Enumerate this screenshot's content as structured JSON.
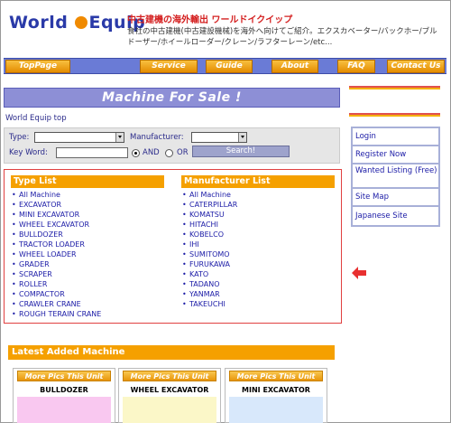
{
  "header": {
    "logo_word1": "World",
    "logo_word2": "quip",
    "logo_letter": "E",
    "tagline": "中古建機の海外輸出 ワールドイクイップ",
    "description": "食社の中古建機(中古建設機械)を海外へ向けてご紹介。エクスカベーター/バックホー/ブルドーザー/ホイールローダー/クレーン/ラフターレーン/etc..."
  },
  "nav": {
    "items": [
      {
        "label": "TopPage"
      },
      {
        "label": "Service"
      },
      {
        "label": "Guide"
      },
      {
        "label": "About"
      },
      {
        "label": "FAQ"
      },
      {
        "label": "Contact Us"
      }
    ]
  },
  "main": {
    "banner_title": "Machine For Sale !",
    "breadcrumb": "World Equip top"
  },
  "search": {
    "type_label": "Type:",
    "type_value": "",
    "manufacturer_label": "Manufacturer:",
    "manufacturer_value": "",
    "keyword_label": "Key Word:",
    "keyword_value": "",
    "and_label": "AND",
    "or_label": "OR",
    "search_button": "Search!"
  },
  "type_list": {
    "heading": "Type List",
    "items": [
      "All Machine",
      "EXCAVATOR",
      "MINI EXCAVATOR",
      "WHEEL EXCAVATOR",
      "BULLDOZER",
      "TRACTOR LOADER",
      "WHEEL LOADER",
      "GRADER",
      "SCRAPER",
      "ROLLER",
      "COMPACTOR",
      "CRAWLER CRANE",
      "ROUGH TERAIN CRANE"
    ]
  },
  "manufacturer_list": {
    "heading": "Manufacturer List",
    "items": [
      "All Machine",
      "CATERPILLAR",
      "KOMATSU",
      "HITACHI",
      "KOBELCO",
      "IHI",
      "SUMITOMO",
      "FURUKAWA",
      "KATO",
      "TADANO",
      "YANMAR",
      "TAKEUCHI"
    ]
  },
  "latest": {
    "heading": "Latest Added Machine",
    "cards": [
      {
        "pics_label": "More Pics This Unit",
        "name": "BULLDOZER",
        "color": "#f9c8f0"
      },
      {
        "pics_label": "More Pics This Unit",
        "name": "WHEEL EXCAVATOR",
        "color": "#fbf7c8"
      },
      {
        "pics_label": "More Pics This Unit",
        "name": "MINI EXCAVATOR",
        "color": "#d8e8fb"
      }
    ]
  },
  "sidebar": {
    "items": [
      {
        "label": "Login"
      },
      {
        "label": "Register Now"
      },
      {
        "label": "Wanted Listing (Free)"
      },
      {
        "label": "Site Map"
      },
      {
        "label": "Japanese Site"
      }
    ]
  },
  "colors": {
    "accent_orange": "#f5a000",
    "nav_blue": "#6a7bd6",
    "link_blue": "#1a1aa6",
    "highlight_red": "#e04040"
  }
}
